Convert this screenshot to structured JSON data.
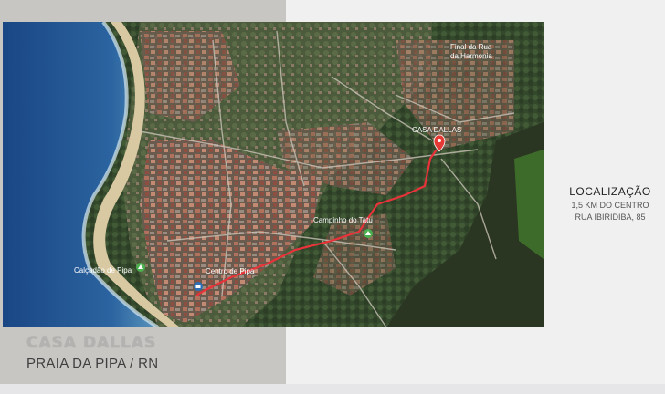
{
  "brand": {
    "title": "CASA DALLAS",
    "subtitle": "PRAIA DA PIPA / RN"
  },
  "location": {
    "title": "LOCALIZAÇÃO",
    "distance": "1,5 KM DO CENTRO",
    "address": "RUA IBIRIDIBA, 85"
  },
  "map": {
    "labels": {
      "rua_harmonia_1": "Final da Rua",
      "rua_harmonia_2": "da Harmonia",
      "casa_dallas": "CASA DALLAS",
      "campinho": "Campinho do Tatu",
      "centro": "Centro de Pipa",
      "calcadao": "Calçadão de Pipa"
    },
    "colors": {
      "ocean_deep": "#1e4f8c",
      "ocean_shallow": "#3f7fae",
      "sand": "#d9c9a3",
      "vegetation": "#3d5133",
      "route": "#e8333a",
      "pin": "#e53935",
      "poi_green": "#4caf50",
      "poi_blue": "#2e6fb5"
    }
  }
}
